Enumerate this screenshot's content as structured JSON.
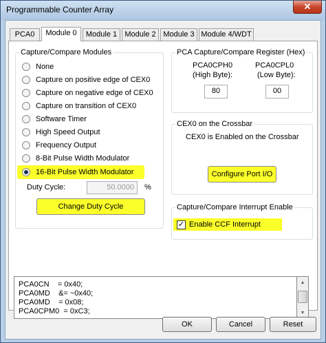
{
  "window": {
    "title": "Programmable Counter Array",
    "close_glyph": "✕"
  },
  "tabs": [
    {
      "label": "PCA0",
      "active": false
    },
    {
      "label": "Module 0",
      "active": true
    },
    {
      "label": "Module 1",
      "active": false
    },
    {
      "label": "Module 2",
      "active": false
    },
    {
      "label": "Module 3",
      "active": false
    },
    {
      "label": "Module 4/WDT",
      "active": false
    }
  ],
  "capture_compare_modules": {
    "title": "Capture/Compare Modules",
    "options": [
      {
        "label": "None",
        "selected": false
      },
      {
        "label": "Capture on positive edge of CEX0",
        "selected": false
      },
      {
        "label": "Capture on negative edge of CEX0",
        "selected": false
      },
      {
        "label": "Capture on transition of CEX0",
        "selected": false
      },
      {
        "label": "Software Timer",
        "selected": false
      },
      {
        "label": "High Speed Output",
        "selected": false
      },
      {
        "label": "Frequency Output",
        "selected": false
      },
      {
        "label": "8-Bit Pulse Width Modulator",
        "selected": false
      },
      {
        "label": "16-Bit Pulse Width Modulator",
        "selected": true
      }
    ],
    "duty_cycle_label": "Duty Cycle:",
    "duty_cycle_value": "50.0000",
    "duty_cycle_unit": "%",
    "change_duty_cycle_button": "Change Duty Cycle"
  },
  "capture_compare_register": {
    "title": "PCA Capture/Compare Register (Hex)",
    "high_label_1": "PCA0CPH0",
    "high_label_2": "(High Byte):",
    "high_value": "80",
    "low_label_1": "PCA0CPL0",
    "low_label_2": "(Low Byte):",
    "low_value": "00"
  },
  "crossbar": {
    "title": "CEX0 on the Crossbar",
    "status": "CEX0 is Enabled on the Crossbar",
    "configure_button": "Configure Port I/O"
  },
  "interrupt": {
    "title": "Capture/Compare Interrupt Enable",
    "checkbox_label": "Enable CCF Interrupt",
    "checked": true,
    "check_glyph": "✓"
  },
  "code_lines": [
    "PCA0CN    = 0x40;",
    "PCA0MD    &= ~0x40;",
    "PCA0MD    = 0x08;",
    "PCA0CPM0  = 0xC3;"
  ],
  "scrollbar": {
    "up_glyph": "▲",
    "down_glyph": "▼"
  },
  "footer": {
    "ok": "OK",
    "cancel": "Cancel",
    "reset": "Reset"
  },
  "colors": {
    "highlight": "#fbff2a",
    "title_bar": "#b9cfe6",
    "close_button": "#c9462c"
  }
}
